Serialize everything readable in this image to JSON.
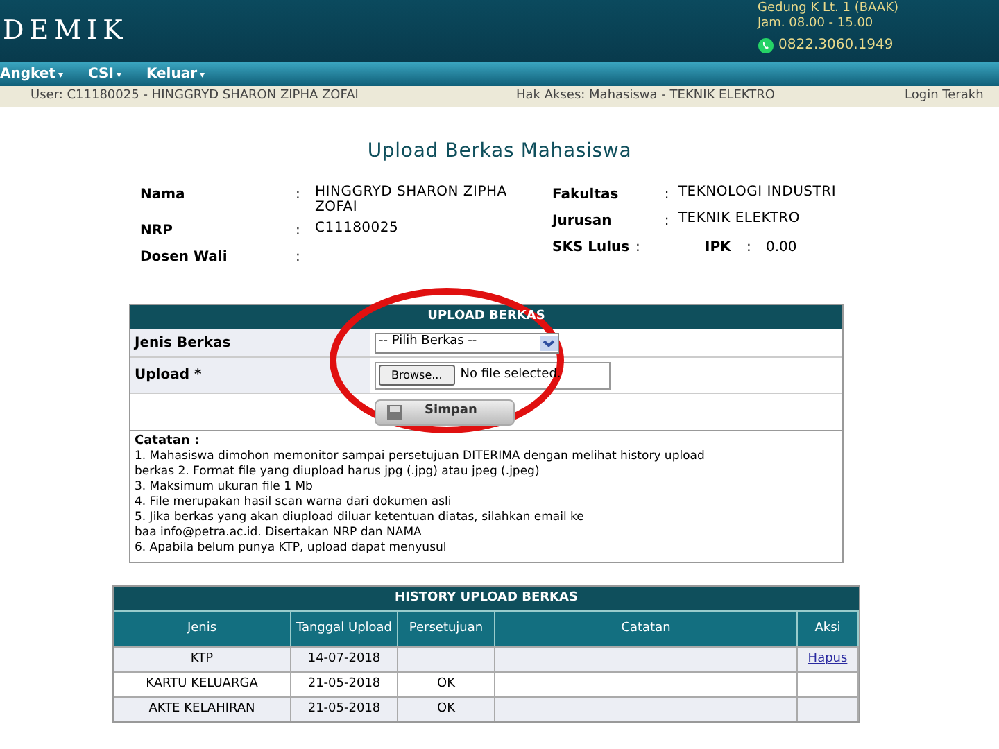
{
  "header": {
    "logo_text": "DEMIK",
    "office": "Gedung K Lt. 1 (BAAK)",
    "hours": "Jam. 08.00 - 15.00",
    "phone": "0822.3060.1949"
  },
  "menu": [
    {
      "label": "Angket",
      "caret": "▾"
    },
    {
      "label": "CSI",
      "caret": "▾"
    },
    {
      "label": "Keluar",
      "caret": "▾"
    }
  ],
  "info_bar": {
    "user": "User: C11180025 - HINGGRYD SHARON ZIPHA ZOFAI",
    "access": "Hak Akses: Mahasiswa - TEKNIK ELEKTRO",
    "login": "Login Terakh"
  },
  "page_title": "Upload Berkas Mahasiswa",
  "student": {
    "left": [
      {
        "label": "Nama",
        "sep": ":",
        "value": "HINGGRYD SHARON ZIPHA ZOFAI"
      },
      {
        "label": "NRP",
        "sep": ":",
        "value": "C11180025"
      },
      {
        "label": "Dosen Wali",
        "sep": ":"
      }
    ],
    "right": [
      {
        "label": "Fakultas",
        "sep": ":",
        "value": "TEKNOLOGI INDUSTRI"
      },
      {
        "label": "Jurusan",
        "sep": ":",
        "value": "TEKNIK ELEKTRO"
      },
      {
        "label": "SKS Lulus",
        "sep": ":"
      }
    ],
    "ipk": {
      "label": "IPK",
      "sep": ":",
      "value": "0.00"
    }
  },
  "upload_form": {
    "title": "UPLOAD BERKAS",
    "type_label": "Jenis Berkas",
    "type_value": "-- Pilih Berkas --",
    "file_label": "Upload *",
    "browse": "Browse...",
    "file_status": "No file selected.",
    "save": "Simpan"
  },
  "notes": {
    "title": "Catatan :",
    "lines": [
      "1. Mahasiswa dimohon memonitor sampai persetujuan DITERIMA dengan melihat history upload",
      "berkas 2. Format file yang diupload harus jpg (.jpg) atau jpeg (.jpeg)",
      "3. Maksimum ukuran file 1 Mb",
      "4. File merupakan hasil scan warna dari dokumen asli",
      "5. Jika berkas yang akan diupload diluar ketentuan diatas, silahkan email ke",
      "baa info@petra.ac.id. Disertakan NRP dan NAMA",
      "6. Apabila belum punya KTP, upload dapat menyusul"
    ]
  },
  "history": {
    "title": "HISTORY UPLOAD BERKAS",
    "columns": [
      "Jenis",
      "Tanggal Upload",
      "Persetujuan",
      "Catatan",
      "Aksi"
    ],
    "rows": [
      {
        "jenis": "KTP",
        "tanggal": "14-07-2018",
        "aksi": "Hapus"
      },
      {
        "jenis": "KARTU KELUARGA",
        "tanggal": "21-05-2018",
        "persetujuan": "OK"
      },
      {
        "jenis": "AKTE KELAHIRAN",
        "tanggal": "21-05-2018",
        "persetujuan": "OK"
      }
    ]
  },
  "annotation": {
    "kind": "ellipse"
  }
}
